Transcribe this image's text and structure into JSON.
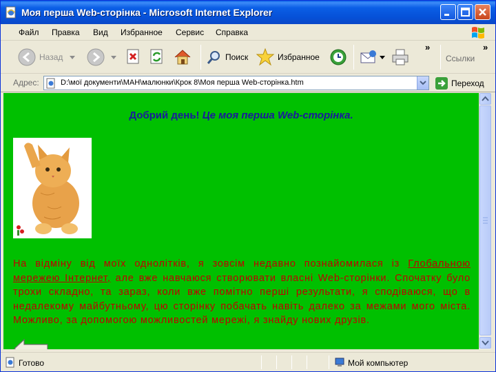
{
  "window": {
    "title": "Моя перша Web-сторінка - Microsoft Internet Explorer"
  },
  "menu": {
    "items": [
      "Файл",
      "Правка",
      "Вид",
      "Избранное",
      "Сервис",
      "Справка"
    ]
  },
  "toolbar": {
    "back_label": "Назад",
    "search_label": "Поиск",
    "favorites_label": "Избранное",
    "overflow_glyph": "»",
    "links_label": "Ссылки"
  },
  "address": {
    "label": "Адрес:",
    "value": "D:\\мої документи\\МАН\\малюнки\\Крок 8\\Моя перша Web-сторінка.htm",
    "go_label": "Переход"
  },
  "page": {
    "heading_bold": "Добрий день!",
    "heading_italic": "Це моя перша Web-сторінка.",
    "text_before_link": "На відміну від моїх однолітків, я зовсім недавно познайомилася із",
    "link_text": "Глобальною мережею Інтернет,",
    "text_after_link": "але вже навчаюся створювати власні Web-сторінки. Спочатку було трохи складно, та зараз, коли вже помітно перші результати, я сподіваюся, що в недалекому майбутньому, цю сторінку побачать навіть далеко за межами мого міста. Можливо, за допомогою можливостей мережі, я знайду нових друзів."
  },
  "status": {
    "text": "Готово",
    "zone": "Мой компьютер"
  },
  "colors": {
    "page_background": "#00c000",
    "heading": "#1a1a9c",
    "body_text": "#c00000",
    "titlebar": "#0a5ee6"
  }
}
